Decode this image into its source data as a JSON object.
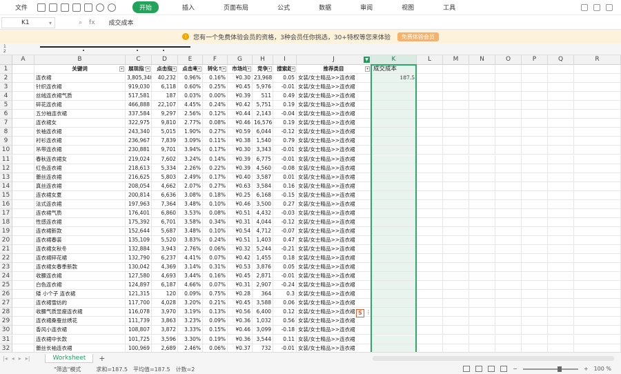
{
  "menubar": {
    "file": "文件",
    "tabs": [
      "开始",
      "插入",
      "页面布局",
      "公式",
      "数据",
      "审阅",
      "视图",
      "工具"
    ],
    "active_tab": 0
  },
  "formula_bar": {
    "name_box": "K1",
    "fx": "fx",
    "content": "成交成本"
  },
  "notice": {
    "text": "您有一个免费体验会员的资格，3种会员任你挑选，30+特权等您来体验",
    "button": "免费体验会员"
  },
  "columns": [
    "A",
    "B",
    "C",
    "D",
    "E",
    "F",
    "G",
    "H",
    "I",
    "J",
    "K",
    "L",
    "M",
    "N",
    "O",
    "P",
    "Q",
    "R"
  ],
  "header_row": [
    "关键词",
    "展现指↑",
    "点击指",
    "点击率",
    "转化↑",
    "市场均",
    "竞争",
    "搜索趋",
    "推荐类目",
    "成交成本"
  ],
  "rows": [
    [
      "连衣裙",
      "3,805,340",
      "40,232",
      "0.96%",
      "0.16%",
      "¥0.30",
      "23,968",
      "0.05",
      "女装/女士精品>>连衣裙"
    ],
    [
      "针织连衣裙",
      "919,030",
      "6,118",
      "0.60%",
      "0.25%",
      "¥0.45",
      "5,976",
      "-0.01",
      "女装/女士精品>>连衣裙"
    ],
    [
      "丝绒连衣裙气质",
      "517,581",
      "187",
      "0.03%",
      "0.00%",
      "¥0.39",
      "511",
      "0.49",
      "女装/女士精品>>连衣裙"
    ],
    [
      "碎花连衣裙",
      "466,888",
      "22,107",
      "4.45%",
      "0.24%",
      "¥0.42",
      "5,751",
      "0.19",
      "女装/女士精品>>连衣裙"
    ],
    [
      "五分袖连衣裙",
      "337,584",
      "9,297",
      "2.56%",
      "0.12%",
      "¥0.44",
      "2,143",
      "-0.04",
      "女装/女士精品>>连衣裙"
    ],
    [
      "连衣裙女",
      "322,975",
      "9,810",
      "2.77%",
      "0.08%",
      "¥0.46",
      "16,576",
      "0.19",
      "女装/女士精品>>连衣裙"
    ],
    [
      "长袖连衣裙",
      "243,340",
      "5,015",
      "1.90%",
      "0.27%",
      "¥0.59",
      "6,044",
      "-0.12",
      "女装/女士精品>>连衣裙"
    ],
    [
      "衬衫连衣裙",
      "236,967",
      "7,839",
      "3.09%",
      "0.11%",
      "¥0.38",
      "1,540",
      "0.79",
      "女装/女士精品>>连衣裙"
    ],
    [
      "吊带连衣裙",
      "230,881",
      "9,701",
      "3.94%",
      "0.17%",
      "¥0.30",
      "3,343",
      "-0.01",
      "女装/女士精品>>连衣裙"
    ],
    [
      "春秋连衣裙女",
      "219,024",
      "7,602",
      "3.24%",
      "0.14%",
      "¥0.39",
      "6,775",
      "-0.01",
      "女装/女士精品>>连衣裙"
    ],
    [
      "红色连衣裙",
      "218,613",
      "5,334",
      "2.26%",
      "0.22%",
      "¥0.39",
      "4,560",
      "-0.08",
      "女装/女士精品>>连衣裙"
    ],
    [
      "蕾丝连衣裙",
      "216,625",
      "5,803",
      "2.49%",
      "0.17%",
      "¥0.40",
      "3,587",
      "0.01",
      "女装/女士精品>>连衣裙"
    ],
    [
      "真丝连衣裙",
      "208,054",
      "4,662",
      "2.07%",
      "0.27%",
      "¥0.63",
      "3,584",
      "0.16",
      "女装/女士精品>>连衣裙"
    ],
    [
      "连衣裙女夏",
      "200,814",
      "6,636",
      "3.08%",
      "0.18%",
      "¥0.25",
      "6,168",
      "-0.15",
      "女装/女士精品>>连衣裙"
    ],
    [
      "法式连衣裙",
      "197,963",
      "7,364",
      "3.48%",
      "0.10%",
      "¥0.46",
      "3,500",
      "0.27",
      "女装/女士精品>>连衣裙"
    ],
    [
      "连衣裙气质",
      "176,401",
      "6,860",
      "3.53%",
      "0.08%",
      "¥0.51",
      "4,432",
      "-0.03",
      "女装/女士精品>>连衣裙"
    ],
    [
      "性感连衣裙",
      "175,392",
      "6,701",
      "3.58%",
      "0.34%",
      "¥0.31",
      "4,044",
      "-0.12",
      "女装/女士精品>>连衣裙"
    ],
    [
      "连衣裙新款",
      "152,644",
      "5,687",
      "3.48%",
      "0.10%",
      "¥0.54",
      "4,712",
      "-0.07",
      "女装/女士精品>>连衣裙"
    ],
    [
      "连衣裙春装",
      "135,109",
      "5,520",
      "3.83%",
      "0.24%",
      "¥0.51",
      "1,403",
      "0.47",
      "女装/女士精品>>连衣裙"
    ],
    [
      "连衣裙女秋冬",
      "132,884",
      "3,943",
      "2.76%",
      "0.06%",
      "¥0.32",
      "5,244",
      "-0.21",
      "女装/女士精品>>连衣裙"
    ],
    [
      "连衣裙碎花裙",
      "132,790",
      "6,237",
      "4.41%",
      "0.07%",
      "¥0.42",
      "1,455",
      "0.18",
      "女装/女士精品>>连衣裙"
    ],
    [
      "连衣裙女春季新款",
      "130,042",
      "4,369",
      "3.14%",
      "0.31%",
      "¥0.53",
      "3,876",
      "0.05",
      "女装/女士精品>>连衣裙"
    ],
    [
      "收腰连衣裙",
      "127,580",
      "4,693",
      "3.44%",
      "0.16%",
      "¥0.45",
      "2,871",
      "-0.01",
      "女装/女士精品>>连衣裙"
    ],
    [
      "白色连衣裙",
      "124,897",
      "6,187",
      "4.66%",
      "0.07%",
      "¥0.31",
      "2,907",
      "-0.24",
      "女装/女士精品>>连衣裙"
    ],
    [
      "矮 小个子 连衣裙",
      "121,315",
      "120",
      "0.09%",
      "0.75%",
      "¥0.28",
      "364",
      "0.3",
      "女装/女士精品>>连衣裙"
    ],
    [
      "连衣裙雪纺的",
      "117,700",
      "4,028",
      "3.20%",
      "0.21%",
      "¥0.45",
      "3,588",
      "0.06",
      "女装/女士精品>>连衣裙"
    ],
    [
      "收腰气质显瘦连衣裙",
      "116,078",
      "3,970",
      "3.19%",
      "0.13%",
      "¥0.56",
      "6,400",
      "0.12",
      "女装/女士精品>>连衣裙"
    ],
    [
      "连衣裙桑蚕丝绣花",
      "111,739",
      "3,863",
      "3.23%",
      "0.09%",
      "¥0.36",
      "1,032",
      "0.56",
      "女装/女士精品>>连衣裙"
    ],
    [
      "香风小连衣裙",
      "108,807",
      "3,872",
      "3.33%",
      "0.15%",
      "¥0.46",
      "3,099",
      "-0.18",
      "女装/女士精品>>连衣裙"
    ],
    [
      "连衣裙中长款",
      "101,725",
      "3,596",
      "3.30%",
      "0.19%",
      "¥0.36",
      "3,544",
      "0.11",
      "女装/女士精品>>连衣裙"
    ],
    [
      "蕾丝长袖连衣裙",
      "100,969",
      "2,689",
      "2.46%",
      "0.06%",
      "¥0.37",
      "732",
      "-0.01",
      "女装/女士精品>>连衣裙"
    ]
  ],
  "k2_value": "187.5",
  "sheet": {
    "tab": "Worksheet",
    "add": "+"
  },
  "status": {
    "mode": "\"筛选\"模式",
    "sum": "求和=187.5",
    "avg": "平均值=187.5",
    "count": "计数=2",
    "zoom": "100 %"
  },
  "colors": {
    "accent": "#22a35a",
    "selection": "#2aa86a",
    "notice_bg": "#fdf2dc"
  }
}
